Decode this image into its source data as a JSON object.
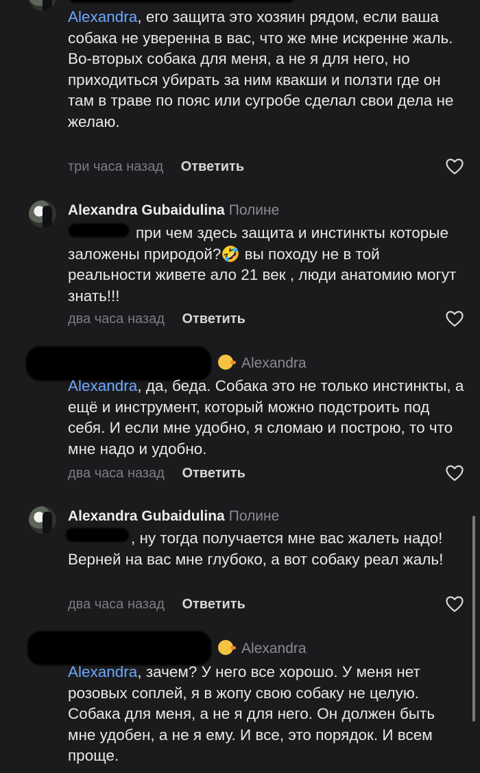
{
  "reply_label": "Ответить",
  "comments": [
    {
      "author": "",
      "reply_to": "",
      "mention": "Alexandra",
      "text": ", его защита это хозяин рядом, если ваша собака не уверенна в вас, что же мне искренне жаль.\nВо-вторых собака для меня, а не я для него, но приходиться убирать за ним квакши и ползти где он там в траве по пояс или сугробе сделал свои дела не желаю.",
      "time": "три часа назад"
    },
    {
      "author": "Alexandra Gubaidulina",
      "reply_to": "Полине",
      "mention": "",
      "text": "при чем здесь защита и инстинкты которые заложены природой?🤣 вы походу не в той реальности живете ало 21 век , люди анатомию могут знать!!!",
      "time": "два часа назад"
    },
    {
      "author": "",
      "reply_to": "Alexandra",
      "mention": "Alexandra",
      "text": ", да, беда. Собака это не только инстинкты, а ещё и инструмент, который можно подстроить под себя. И если мне удобно, я сломаю и построю, то что мне надо и удобно.",
      "time": "два часа назад"
    },
    {
      "author": "Alexandra Gubaidulina",
      "reply_to": "Полине",
      "mention": "",
      "text": ", ну тогда получается мне вас жалеть надо! Верней на вас мне глубоко, а вот собаку реал жаль!",
      "time": "два часа назад"
    },
    {
      "author": "",
      "reply_to": "Alexandra",
      "mention": "Alexandra",
      "text": ", зачем? У него все хорошо. У меня нет розовых соплей, я в жопу свою собаку не целую. Собака для меня, а не я для него. Он должен быть мне удобен, а не я ему. И все, это порядок. И всем проще.",
      "time": ""
    }
  ],
  "icons": {
    "like": "heart-outline-icon",
    "duck": "duck-emoji-icon"
  }
}
